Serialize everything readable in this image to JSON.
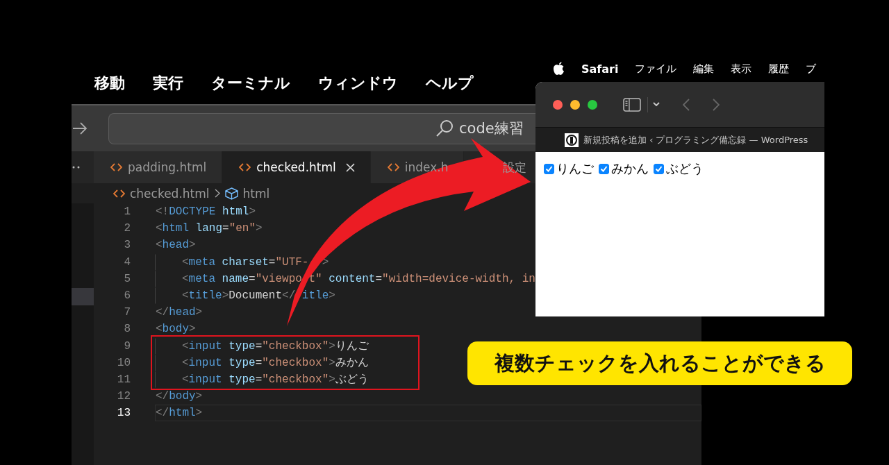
{
  "vscode": {
    "menu": [
      "移動",
      "実行",
      "ターミナル",
      "ウィンドウ",
      "ヘルプ"
    ],
    "search": {
      "value": "code練習"
    },
    "tabs": [
      {
        "label": "padding.html",
        "kind": "html",
        "selected": false,
        "closable": false
      },
      {
        "label": "checked.html",
        "kind": "html",
        "selected": true,
        "closable": true
      },
      {
        "label": "index.h",
        "kind": "html",
        "selected": false,
        "closable": false
      },
      {
        "label": "設定",
        "kind": "plain",
        "selected": false,
        "closable": false
      }
    ],
    "breadcrumb": [
      {
        "label": "checked.html",
        "kind": "file"
      },
      {
        "label": "html",
        "kind": "element"
      }
    ],
    "code_lines": [
      {
        "number": "1",
        "selected": false,
        "highlighted": false,
        "tokens": [
          {
            "kind": "punct",
            "text": "<!"
          },
          {
            "kind": "tag",
            "text": "DOCTYPE"
          },
          {
            "kind": "attr",
            "text": " html"
          },
          {
            "kind": "punct",
            "text": ">"
          }
        ]
      },
      {
        "number": "2",
        "selected": false,
        "highlighted": false,
        "tokens": [
          {
            "kind": "punct",
            "text": "<"
          },
          {
            "kind": "tag",
            "text": "html"
          },
          {
            "kind": "attr",
            "text": " lang"
          },
          {
            "kind": "plain",
            "text": "="
          },
          {
            "kind": "string",
            "text": "\"en\""
          },
          {
            "kind": "punct",
            "text": ">"
          }
        ]
      },
      {
        "number": "3",
        "selected": false,
        "highlighted": false,
        "tokens": [
          {
            "kind": "punct",
            "text": "<"
          },
          {
            "kind": "tag",
            "text": "head"
          },
          {
            "kind": "punct",
            "text": ">"
          }
        ],
        "children": [
          {
            "number": "4",
            "selected": false,
            "highlighted": false,
            "tokens": [
              {
                "kind": "punct",
                "text": "<"
              },
              {
                "kind": "tag",
                "text": "meta"
              },
              {
                "kind": "attr",
                "text": " charset"
              },
              {
                "kind": "plain",
                "text": "="
              },
              {
                "kind": "string",
                "text": "\"UTF-"
              },
              {
                "kind": "covered"
              },
              {
                "kind": "covered"
              },
              {
                "kind": "punct",
                "text": ">"
              }
            ]
          },
          {
            "number": "5",
            "selected": false,
            "highlighted": false,
            "tokens": [
              {
                "kind": "punct",
                "text": "<"
              },
              {
                "kind": "tag",
                "text": "meta"
              },
              {
                "kind": "attr",
                "text": " name"
              },
              {
                "kind": "plain",
                "text": "="
              },
              {
                "kind": "string",
                "text": "\"viewpo"
              },
              {
                "kind": "covered"
              },
              {
                "kind": "string",
                "text": "t\""
              },
              {
                "kind": "attr",
                "text": " content"
              },
              {
                "kind": "plain",
                "text": "="
              },
              {
                "kind": "string",
                "text": "\"width=device-width, in"
              }
            ]
          },
          {
            "number": "6",
            "selected": false,
            "highlighted": false,
            "tokens": [
              {
                "kind": "punct",
                "text": "<"
              },
              {
                "kind": "tag",
                "text": "title"
              },
              {
                "kind": "punct",
                "text": ">"
              },
              {
                "kind": "plain",
                "text": "Document"
              },
              {
                "kind": "punct",
                "text": "</"
              },
              {
                "kind": "covered"
              },
              {
                "kind": "tag",
                "text": "itle"
              },
              {
                "kind": "punct",
                "text": ">"
              }
            ]
          }
        ]
      },
      {
        "number": "7",
        "selected": false,
        "highlighted": false,
        "tokens": [
          {
            "kind": "punct",
            "text": "</"
          },
          {
            "kind": "tag",
            "text": "head"
          },
          {
            "kind": "punct",
            "text": ">"
          }
        ]
      },
      {
        "number": "8",
        "selected": false,
        "highlighted": true,
        "tokens": [
          {
            "kind": "punct",
            "text": "<"
          },
          {
            "kind": "tag",
            "text": "body"
          },
          {
            "kind": "punct",
            "text": ">"
          }
        ],
        "children": [
          {
            "number": "9",
            "selected": false,
            "highlighted": false,
            "tokens": [
              {
                "kind": "punct",
                "text": "<"
              },
              {
                "kind": "tag",
                "text": "input"
              },
              {
                "kind": "attr",
                "text": " type"
              },
              {
                "kind": "plain",
                "text": "="
              },
              {
                "kind": "string",
                "text": "\"checkbox\""
              },
              {
                "kind": "punct",
                "text": ">"
              },
              {
                "kind": "plain",
                "text": "りんご"
              }
            ]
          },
          {
            "number": "10",
            "selected": false,
            "highlighted": false,
            "tokens": [
              {
                "kind": "punct",
                "text": "<"
              },
              {
                "kind": "tag",
                "text": "input"
              },
              {
                "kind": "attr",
                "text": " type"
              },
              {
                "kind": "plain",
                "text": "="
              },
              {
                "kind": "string",
                "text": "\"checkbox\""
              },
              {
                "kind": "punct",
                "text": ">"
              },
              {
                "kind": "plain",
                "text": "みかん"
              }
            ]
          },
          {
            "number": "11",
            "selected": false,
            "highlighted": false,
            "tokens": [
              {
                "kind": "punct",
                "text": "<"
              },
              {
                "kind": "tag",
                "text": "input"
              },
              {
                "kind": "attr",
                "text": " type"
              },
              {
                "kind": "plain",
                "text": "="
              },
              {
                "kind": "string",
                "text": "\"checkbox\""
              },
              {
                "kind": "punct",
                "text": ">"
              },
              {
                "kind": "plain",
                "text": "ぶどう"
              }
            ]
          }
        ]
      },
      {
        "number": "12",
        "selected": false,
        "highlighted": false,
        "tokens": [
          {
            "kind": "punct",
            "text": "</"
          },
          {
            "kind": "tag",
            "text": "body"
          },
          {
            "kind": "punct",
            "text": ">"
          }
        ]
      },
      {
        "number": "13",
        "selected": true,
        "highlighted": false,
        "tokens": [
          {
            "kind": "punct",
            "text": "</"
          },
          {
            "kind": "tag",
            "text": "html"
          },
          {
            "kind": "punct",
            "text": ">"
          }
        ]
      }
    ]
  },
  "safari": {
    "menu": [
      {
        "label": "Safari",
        "bold": true
      },
      {
        "label": "ファイル",
        "bold": false
      },
      {
        "label": "編集",
        "bold": false
      },
      {
        "label": "表示",
        "bold": false
      },
      {
        "label": "履歴",
        "bold": false
      },
      {
        "label": "ブ",
        "bold": false
      }
    ],
    "tab_title": "新規投稿を追加 ‹ プログラミング備忘録 — WordPress",
    "checkboxes": [
      {
        "label": "りんご",
        "checked": true
      },
      {
        "label": "みかん",
        "checked": true
      },
      {
        "label": "ぶどう",
        "checked": true
      }
    ]
  },
  "callout": "複数チェックを入れることができる"
}
